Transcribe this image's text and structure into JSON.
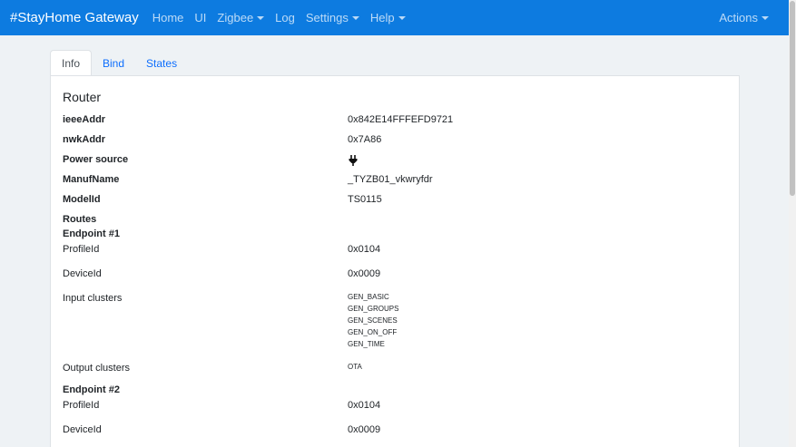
{
  "navbar": {
    "brand": "#StayHome Gateway",
    "links": [
      "Home",
      "UI",
      "Zigbee",
      "Log",
      "Settings",
      "Help"
    ],
    "actions": "Actions",
    "color": "#0d7be0"
  },
  "tabs": [
    "Info",
    "Bind",
    "States"
  ],
  "device": {
    "title": "Router",
    "ieee_label": "ieeeAddr",
    "ieee": "0x842E14FFFEFD9721",
    "nwk_label": "nwkAddr",
    "nwk": "0x7A86",
    "power_label": "Power source",
    "power_icon": "plug-icon",
    "manuf_label": "ManufName",
    "manuf": "_TYZB01_vkwryfdr",
    "model_label": "ModelId",
    "model": "TS0115",
    "routes_label": "Routes"
  },
  "endpoints": [
    {
      "title": "Endpoint #1",
      "profile_label": "ProfileId",
      "profile": "0x0104",
      "device_label": "DeviceId",
      "device": "0x0009",
      "input_label": "Input clusters",
      "input_clusters": [
        "GEN_BASIC",
        "GEN_GROUPS",
        "GEN_SCENES",
        "GEN_ON_OFF",
        "GEN_TIME"
      ],
      "output_label": "Output clusters",
      "output_clusters": [
        "OTA"
      ]
    },
    {
      "title": "Endpoint #2",
      "profile_label": "ProfileId",
      "profile": "0x0104",
      "device_label": "DeviceId",
      "device": "0x0009"
    }
  ]
}
